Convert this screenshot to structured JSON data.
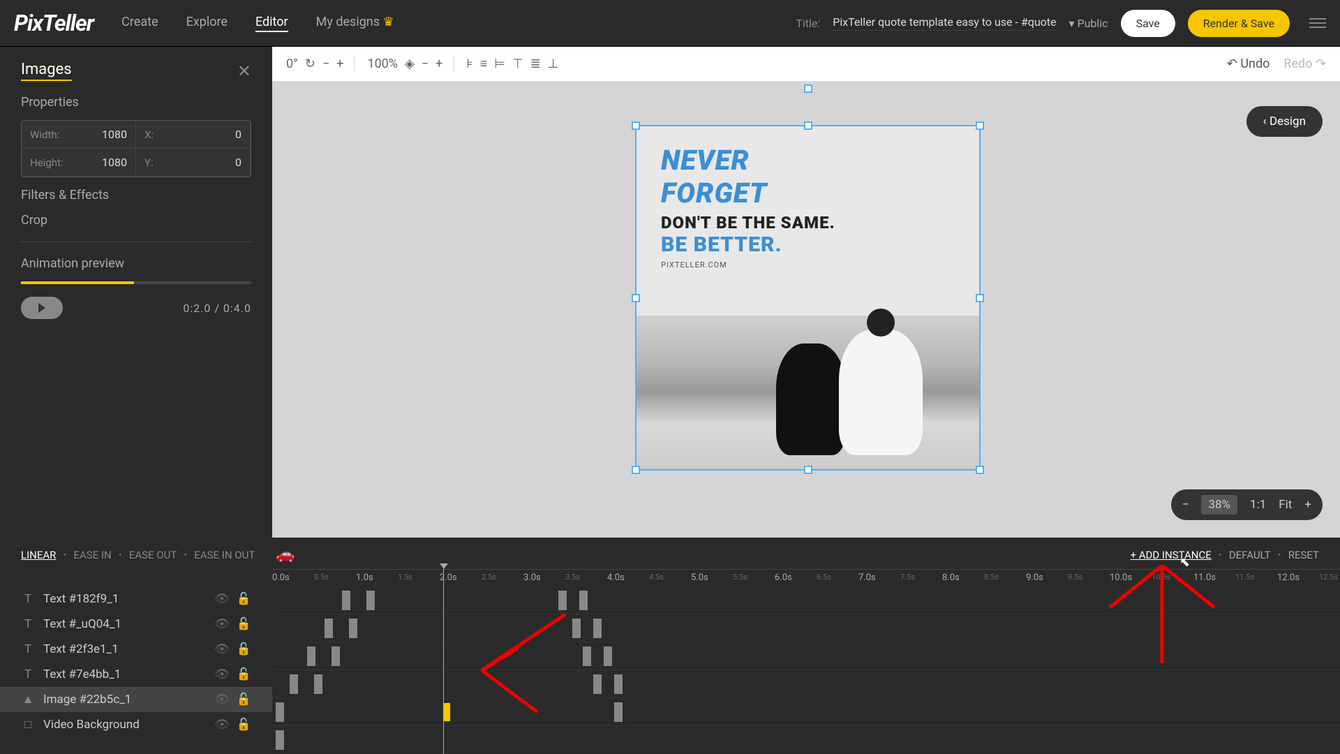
{
  "header": {
    "logo": "PixTeller",
    "nav": {
      "create": "Create",
      "explore": "Explore",
      "editor": "Editor",
      "mydesigns": "My designs"
    },
    "title_label": "Title:",
    "title_value": "PixTeller quote template easy to use - #quote",
    "visibility": "Public",
    "save": "Save",
    "render": "Render & Save"
  },
  "toolbar": {
    "rotation": "0°",
    "zoom": "100%",
    "undo": "Undo",
    "redo": "Redo"
  },
  "sidebar": {
    "title": "Images",
    "properties_label": "Properties",
    "width_label": "Width:",
    "width_value": "1080",
    "height_label": "Height:",
    "height_value": "1080",
    "x_label": "X:",
    "x_value": "0",
    "y_label": "Y:",
    "y_value": "0",
    "filters": "Filters & Effects",
    "crop": "Crop",
    "anim_label": "Animation preview",
    "anim_time": "0:2.0 / 0:4.0"
  },
  "canvas": {
    "design_badge": "‹ Design",
    "q1": "NEVER",
    "q2": "FORGET",
    "q3": "DON'T BE THE SAME.",
    "q4": "BE BETTER.",
    "q5": "PIXTELLER.COM",
    "zoom_pct": "38%",
    "zoom_ratio": "1:1",
    "zoom_fit": "Fit"
  },
  "timeline": {
    "linear": "LINEAR",
    "easein": "EASE IN",
    "easeout": "EASE OUT",
    "easeinout": "EASE IN OUT",
    "add_instance": "+ ADD INSTANCE",
    "default": "DEFAULT",
    "reset": "RESET",
    "ticks": [
      "0.0s",
      "0.5s",
      "1.0s",
      "1.5s",
      "2.0s",
      "2.5s",
      "3.0s",
      "3.5s",
      "4.0s",
      "4.5s",
      "5.0s",
      "5.5s",
      "6.0s",
      "6.5s",
      "7.0s",
      "7.5s",
      "8.0s",
      "8.5s",
      "9.0s",
      "9.5s",
      "10.0s",
      "10.5s",
      "11.0s",
      "11.5s",
      "12.0s",
      "12.5s"
    ],
    "layers": [
      {
        "icon": "T",
        "name": "Text #182f9_1"
      },
      {
        "icon": "T",
        "name": "Text #_uQ04_1"
      },
      {
        "icon": "T",
        "name": "Text #2f3e1_1"
      },
      {
        "icon": "T",
        "name": "Text #7e4bb_1"
      },
      {
        "icon": "▲",
        "name": "Image #22b5c_1",
        "selected": true
      },
      {
        "icon": "□",
        "name": "Video Background"
      }
    ]
  }
}
